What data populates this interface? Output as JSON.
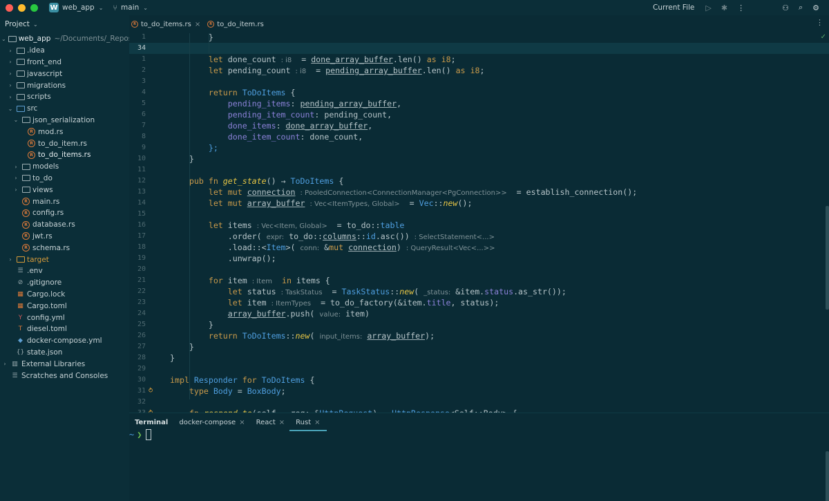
{
  "titlebar": {
    "project_badge": "W",
    "project_name": "web_app",
    "branch": "main",
    "current_file": "Current File"
  },
  "project_panel": {
    "header": "Project",
    "root": {
      "name": "web_app",
      "path": "~/Documents/_Repos"
    },
    "items": [
      {
        "label": ".idea",
        "kind": "folder",
        "expanded": false,
        "depth": 1
      },
      {
        "label": "front_end",
        "kind": "folder",
        "expanded": false,
        "depth": 1
      },
      {
        "label": "javascript",
        "kind": "folder",
        "expanded": false,
        "depth": 1
      },
      {
        "label": "migrations",
        "kind": "folder",
        "expanded": false,
        "depth": 1
      },
      {
        "label": "scripts",
        "kind": "folder",
        "expanded": false,
        "depth": 1
      },
      {
        "label": "src",
        "kind": "folder-blue",
        "expanded": true,
        "depth": 1
      },
      {
        "label": "json_serialization",
        "kind": "folder",
        "expanded": true,
        "depth": 2
      },
      {
        "label": "mod.rs",
        "kind": "rust",
        "depth": 3
      },
      {
        "label": "to_do_item.rs",
        "kind": "rust",
        "depth": 3
      },
      {
        "label": "to_do_items.rs",
        "kind": "rust",
        "depth": 3,
        "selected": true
      },
      {
        "label": "models",
        "kind": "folder",
        "expanded": false,
        "depth": 2
      },
      {
        "label": "to_do",
        "kind": "folder",
        "expanded": false,
        "depth": 2
      },
      {
        "label": "views",
        "kind": "folder",
        "expanded": false,
        "depth": 2
      },
      {
        "label": "main.rs",
        "kind": "rust",
        "depth": 2
      },
      {
        "label": "config.rs",
        "kind": "rust",
        "depth": 2
      },
      {
        "label": "database.rs",
        "kind": "rust",
        "depth": 2
      },
      {
        "label": "jwt.rs",
        "kind": "rust",
        "depth": 2
      },
      {
        "label": "schema.rs",
        "kind": "rust",
        "depth": 2
      },
      {
        "label": "target",
        "kind": "folder-orange",
        "expanded": false,
        "depth": 1
      },
      {
        "label": ".env",
        "kind": "text",
        "depth": 1
      },
      {
        "label": ".gitignore",
        "kind": "ignore",
        "depth": 1
      },
      {
        "label": "Cargo.lock",
        "kind": "cargo",
        "depth": 1
      },
      {
        "label": "Cargo.toml",
        "kind": "cargo",
        "depth": 1
      },
      {
        "label": "config.yml",
        "kind": "yaml",
        "depth": 1
      },
      {
        "label": "diesel.toml",
        "kind": "toml",
        "depth": 1
      },
      {
        "label": "docker-compose.yml",
        "kind": "docker",
        "depth": 1
      },
      {
        "label": "state.json",
        "kind": "json",
        "depth": 1
      },
      {
        "label": "External Libraries",
        "kind": "library",
        "expanded": false,
        "depth": 0
      },
      {
        "label": "Scratches and Consoles",
        "kind": "scratch",
        "depth": 0
      }
    ]
  },
  "editor_tabs": [
    {
      "label": "to_do_items.rs",
      "closable": true,
      "active": true
    },
    {
      "label": "to_do_item.rs",
      "closable": false,
      "active": false
    }
  ],
  "line_numbers": [
    "1",
    "34",
    "1",
    "2",
    "3",
    "4",
    "5",
    "6",
    "7",
    "8",
    "9",
    "10",
    "11",
    "12",
    "13",
    "14",
    "15",
    "16",
    "17",
    "18",
    "19",
    "20",
    "21",
    "22",
    "23",
    "24",
    "25",
    "26",
    "27",
    "28",
    "29",
    "30",
    "31",
    "32",
    "33"
  ],
  "terminal": {
    "tabs": [
      "Terminal",
      "docker-compose",
      "React",
      "Rust"
    ],
    "active_tab": "Rust",
    "prompt_dir": "~",
    "prompt_arrow": "❯"
  },
  "colors": {
    "background": "#0a2b35",
    "keyword": "#c99a4a",
    "type": "#4f9fe0",
    "function": "#e6c545",
    "field": "#8c82d9"
  }
}
